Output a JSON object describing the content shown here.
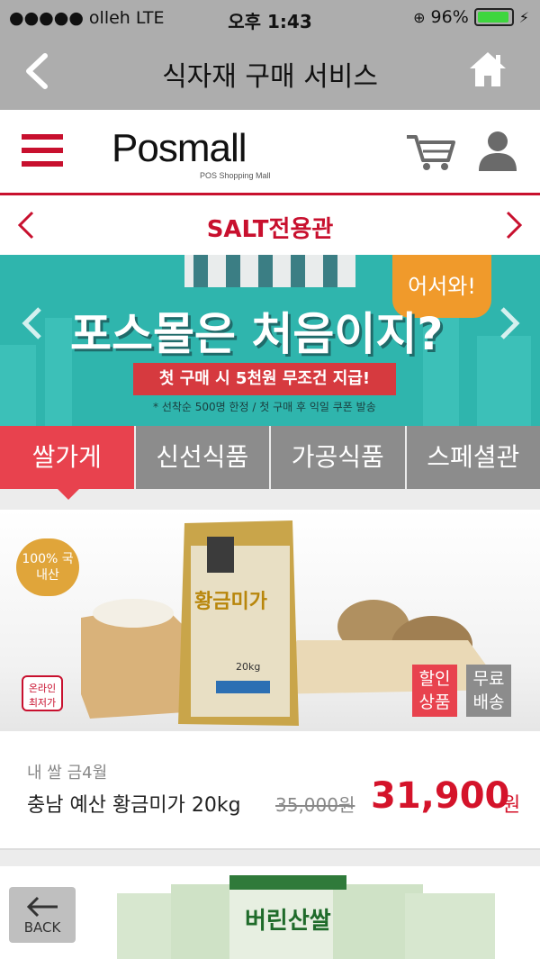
{
  "status_bar": {
    "carrier": "●●●●● olleh   LTE",
    "time": "오후 1:43",
    "battery": "96%",
    "battery_level": 0.96
  },
  "nav": {
    "title": "식자재 구매 서비스"
  },
  "header": {
    "logo": "Posmall",
    "logo_sub": "POS Shopping Mall"
  },
  "category": {
    "label": "SALT전용관"
  },
  "banner": {
    "bubble": "어서와!",
    "headline": "포스몰은 처음이지?",
    "ribbon": "첫 구매 시 5천원 무조건 지급!",
    "note": "* 선착순 500명 한정 / 첫 구매 후 익일 쿠폰 발송"
  },
  "tabs": [
    {
      "label": "쌀가게"
    },
    {
      "label": "신선식품"
    },
    {
      "label": "가공식품"
    },
    {
      "label": "스페셜관"
    }
  ],
  "product": {
    "image_texts": {
      "seal": "100% 국내산",
      "lowest": "온라인 최저가",
      "package_name": "황금미가",
      "package_weight": "20kg"
    },
    "badges": {
      "sale": "할인\n상품",
      "free_shipping": "무료\n배송"
    },
    "brand": "내 쌀 금4월",
    "name": "충남 예산 황금미가 20kg",
    "original_price": "35,000원",
    "price": "31,900",
    "unit": "원"
  },
  "product2": {
    "package_name": "버린산쌀"
  },
  "back_button": {
    "label": "BACK"
  },
  "colors": {
    "accent": "#c8102e",
    "active_tab": "#e8424e",
    "inactive_tab": "#8c8c8c",
    "banner_bg": "#2fb5ad",
    "bar_gray": "#adadad"
  }
}
